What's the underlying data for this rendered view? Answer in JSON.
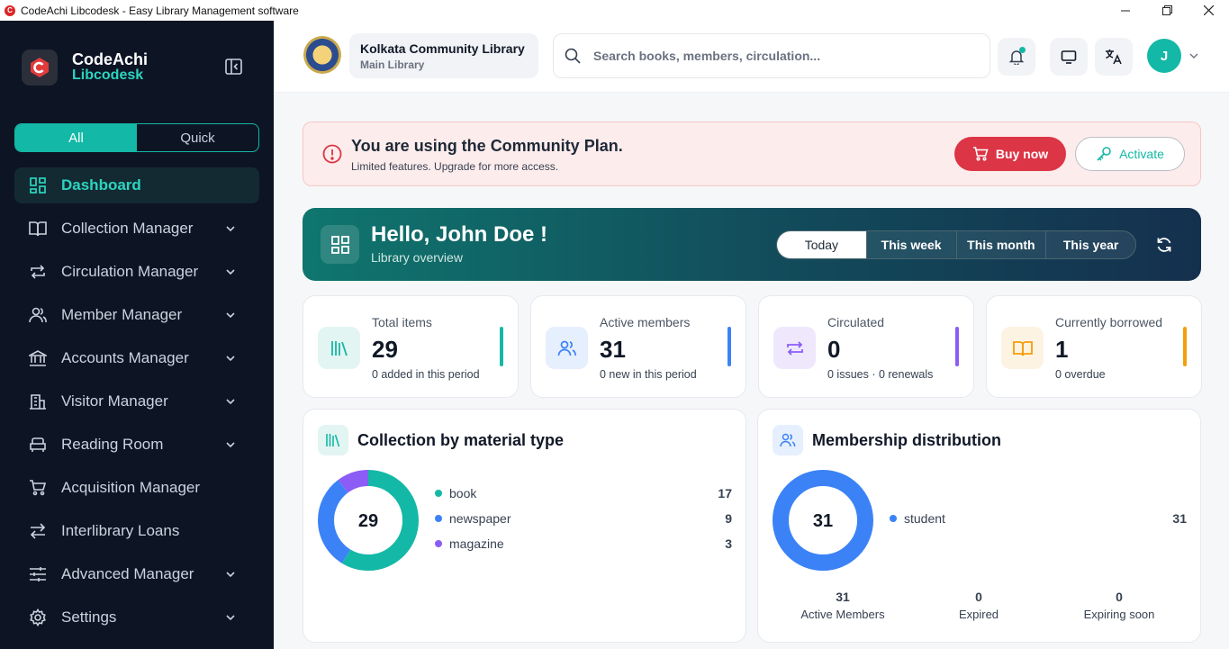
{
  "window": {
    "title": "CodeAchi Libcodesk - Easy Library Management software"
  },
  "brand": {
    "line1": "CodeAchi",
    "line2": "Libcodesk"
  },
  "sidebar": {
    "toggle": {
      "all": "All",
      "quick": "Quick"
    },
    "items": [
      {
        "label": "Dashboard",
        "icon": "dashboard-icon"
      },
      {
        "label": "Collection Manager",
        "icon": "book-icon"
      },
      {
        "label": "Circulation Manager",
        "icon": "repeat-icon"
      },
      {
        "label": "Member Manager",
        "icon": "users-icon"
      },
      {
        "label": "Accounts Manager",
        "icon": "bank-icon"
      },
      {
        "label": "Visitor Manager",
        "icon": "building-icon"
      },
      {
        "label": "Reading Room",
        "icon": "sofa-icon"
      },
      {
        "label": "Acquisition Manager",
        "icon": "cart-icon"
      },
      {
        "label": "Interlibrary Loans",
        "icon": "arrows-icon"
      },
      {
        "label": "Advanced Manager",
        "icon": "sliders-icon"
      },
      {
        "label": "Settings",
        "icon": "gear-icon"
      }
    ]
  },
  "header": {
    "library_name": "Kolkata Community Library",
    "branch": "Main Library",
    "search_placeholder": "Search books, members, circulation...",
    "avatar_initial": "J"
  },
  "plan": {
    "title": "You are using the Community Plan.",
    "subtitle": "Limited features. Upgrade for more access.",
    "buy_label": "Buy now",
    "activate_label": "Activate"
  },
  "hello": {
    "greeting": "Hello, John Doe !",
    "subtitle": "Library overview",
    "periods": [
      "Today",
      "This week",
      "This month",
      "This year"
    ],
    "selected_period": "Today"
  },
  "stats": [
    {
      "label": "Total items",
      "value": "29",
      "sub": "0 added in this period",
      "color": "#14b8a6"
    },
    {
      "label": "Active members",
      "value": "31",
      "sub": "0 new in this period",
      "color": "#3b82f6"
    },
    {
      "label": "Circulated",
      "value": "0",
      "sub": "0 issues · 0 renewals",
      "color": "#8b5cf6"
    },
    {
      "label": "Currently borrowed",
      "value": "1",
      "sub": "0 overdue",
      "color": "#f59e0b"
    }
  ],
  "collection": {
    "title": "Collection by material type",
    "total": "29",
    "items": [
      {
        "label": "book",
        "value": "17",
        "color": "#14b8a6"
      },
      {
        "label": "newspaper",
        "value": "9",
        "color": "#3b82f6"
      },
      {
        "label": "magazine",
        "value": "3",
        "color": "#8b5cf6"
      }
    ]
  },
  "membership": {
    "title": "Membership distribution",
    "total": "31",
    "items": [
      {
        "label": "student",
        "value": "31",
        "color": "#3b82f6"
      }
    ],
    "summary": [
      {
        "value": "31",
        "label": "Active Members"
      },
      {
        "value": "0",
        "label": "Expired"
      },
      {
        "value": "0",
        "label": "Expiring soon"
      }
    ]
  }
}
